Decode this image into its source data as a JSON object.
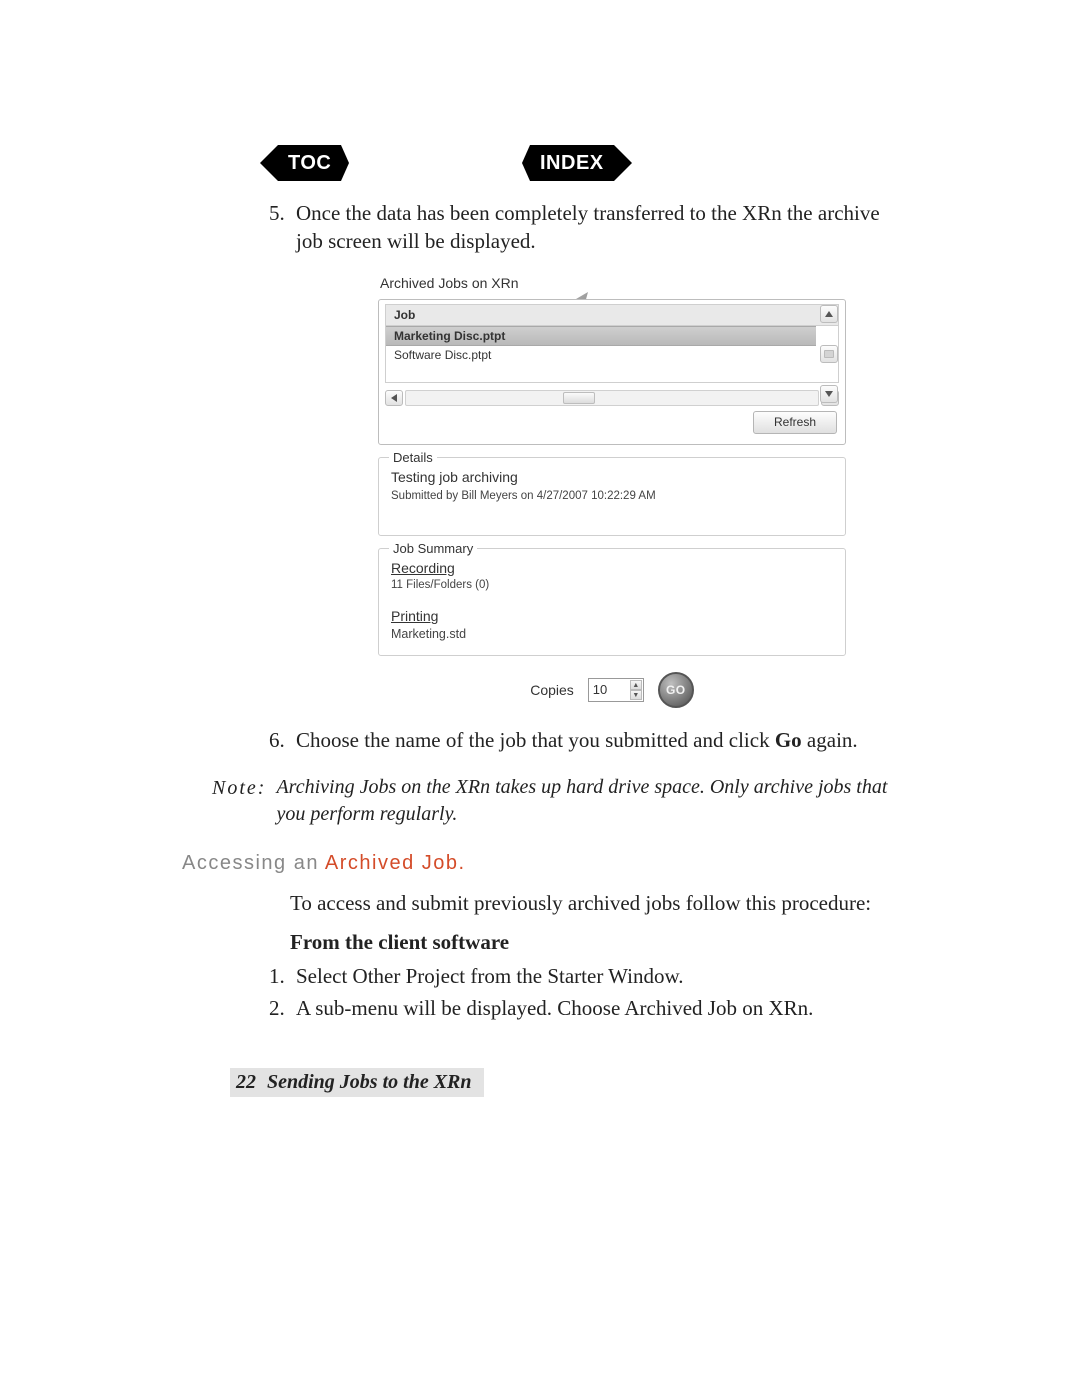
{
  "nav": {
    "toc": "TOC",
    "index": "INDEX"
  },
  "steps_a": {
    "start": 5,
    "items": [
      "Once the data has been completely transferred to the XRn the archive job screen will be displayed.",
      ""
    ],
    "item6_pre": "Choose the name of the job that you submitted and click ",
    "item6_bold": "Go",
    "item6_post": " again."
  },
  "screenshot": {
    "title": "Archived Jobs on XRn",
    "job_header": "Job",
    "jobs": [
      "Marketing Disc.ptpt",
      "Software Disc.ptpt"
    ],
    "refresh": "Refresh",
    "details": {
      "legend": "Details",
      "line": "Testing job archiving",
      "sub": "Submitted by Bill Meyers on 4/27/2007 10:22:29 AM"
    },
    "summary": {
      "legend": "Job Summary",
      "recording": "Recording",
      "rec_sub": "11 Files/Folders (0)",
      "printing": "Printing",
      "print_sub": "Marketing.std"
    },
    "copies_label": "Copies",
    "copies_value": "10",
    "go": "GO"
  },
  "note": {
    "label": "Note:",
    "text": "Archiving Jobs on the XRn takes up hard drive space. Only archive jobs that you perform regularly."
  },
  "section": {
    "pre": "Accessing an ",
    "hl": "Archived Job"
  },
  "access_intro": "To access and submit previously archived jobs follow this procedure:",
  "subhead": "From the client software",
  "steps_b": [
    "Select Other Project from the Starter Window.",
    "A sub-menu will be displayed. Choose Archived Job on XRn."
  ],
  "footer": {
    "page": "22",
    "title": "Sending Jobs to the XRn"
  }
}
